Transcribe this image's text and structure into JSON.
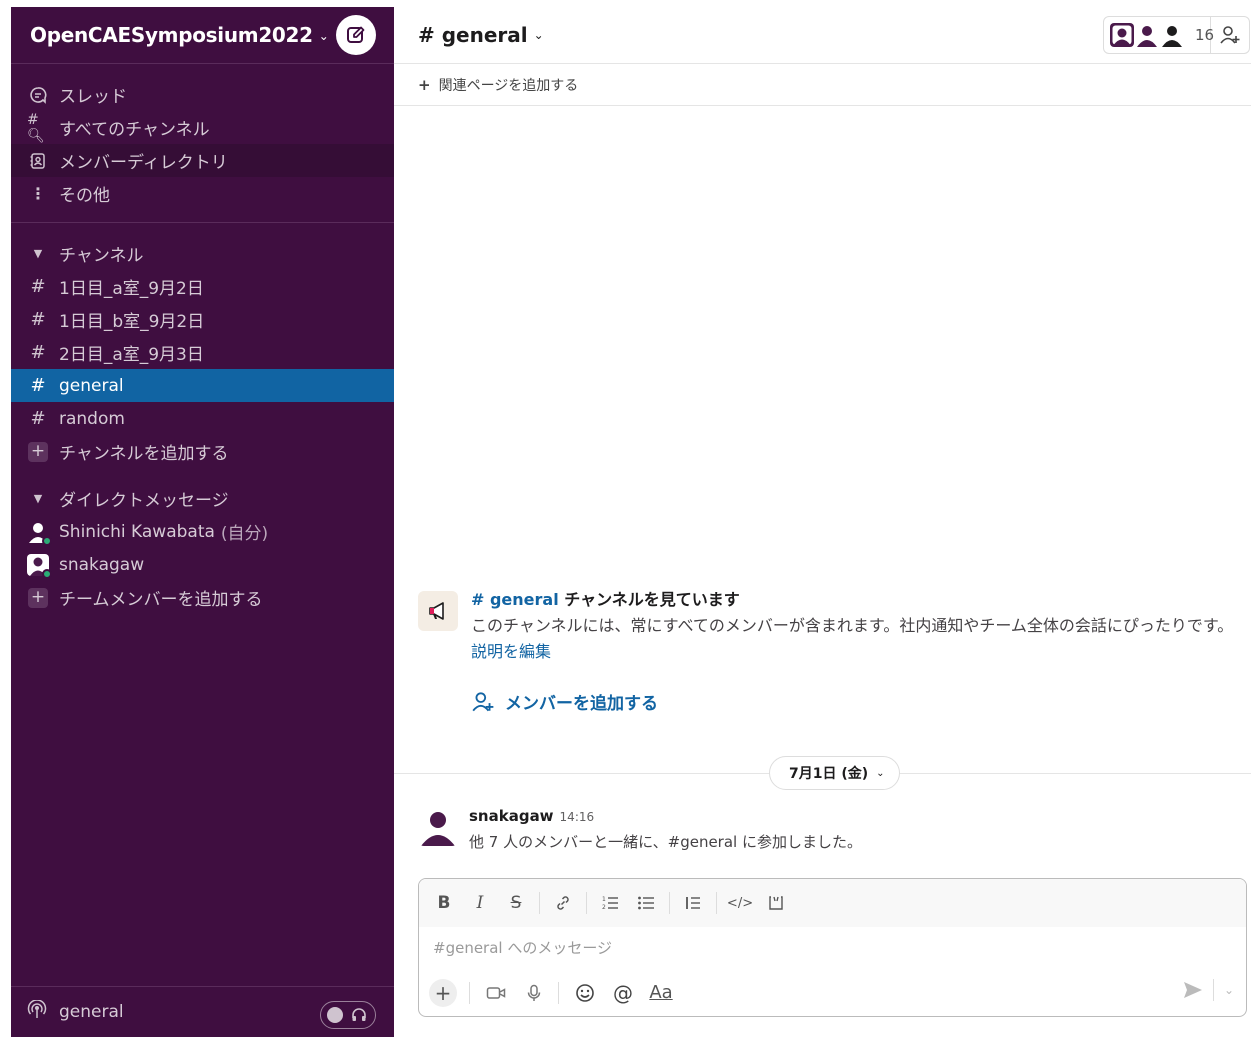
{
  "workspace": {
    "name": "OpenCAESymposium2022"
  },
  "sidebar": {
    "nav": [
      {
        "label": "スレッド",
        "icon": "threads-icon"
      },
      {
        "label": "すべてのチャンネル",
        "icon": "channel-browser-icon"
      },
      {
        "label": "メンバーディレクトリ",
        "icon": "member-directory-icon"
      },
      {
        "label": "その他",
        "icon": "more-vertical-icon"
      }
    ],
    "channels_header": "チャンネル",
    "channels": [
      {
        "name": "1日目_a室_9月2日"
      },
      {
        "name": "1日目_b室_9月2日"
      },
      {
        "name": "2日目_a室_9月3日"
      },
      {
        "name": "general"
      },
      {
        "name": "random"
      }
    ],
    "add_channel": "チャンネルを追加する",
    "dm_header": "ダイレクトメッセージ",
    "dms": [
      {
        "name": "Shinichi Kawabata",
        "self_tag": "(自分)"
      },
      {
        "name": "snakagaw"
      }
    ],
    "add_member": "チームメンバーを追加する",
    "footer_channel": "general"
  },
  "channel": {
    "title": "# general",
    "member_count": "16",
    "bookmark_add": "関連ページを追加する"
  },
  "intro": {
    "channel_link": "# general",
    "title_rest": " チャンネルを見ています",
    "description": "このチャンネルには、常にすべてのメンバーが含まれます。社内通知やチーム全体の会話にぴったりです。",
    "edit_link": "説明を編集",
    "add_members": "メンバーを追加する"
  },
  "date_divider": "7月1日 (金)",
  "messages": [
    {
      "user": "snakagaw",
      "time": "14:16",
      "text": "他 7 人のメンバーと一緒に、#general に参加しました。"
    }
  ],
  "composer": {
    "placeholder": "#general へのメッセージ",
    "format_label": "Aa"
  },
  "colors": {
    "sidebar_bg": "#3f0e40",
    "selected": "#1164a3",
    "link": "#1264a3",
    "online": "#2bac76"
  }
}
